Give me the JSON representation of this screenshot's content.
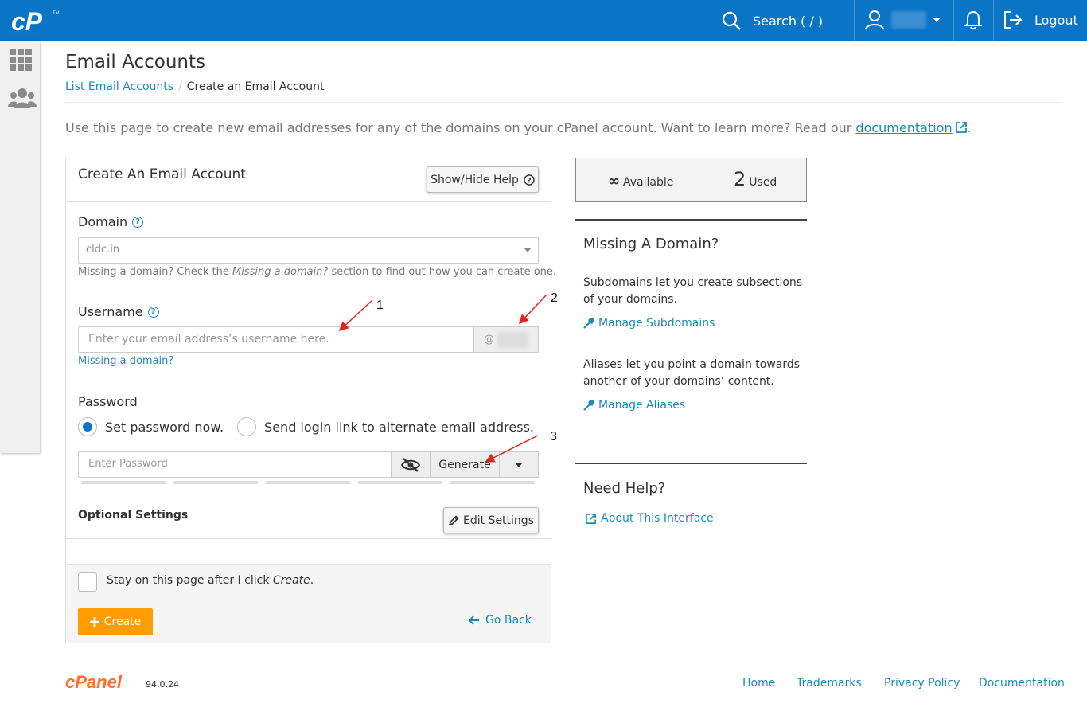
{
  "topbar": {
    "search_label": "Search ( / )",
    "logout_label": "Logout"
  },
  "page": {
    "title": "Email Accounts",
    "breadcrumb_link": "List Email Accounts",
    "breadcrumb_sep": "/",
    "breadcrumb_current": "Create an Email Account",
    "intro_text": "Use this page to create new email addresses for any of the domains on your cPanel account. Want to learn more? Read our",
    "intro_link": "documentation",
    "intro_end": "."
  },
  "form": {
    "title": "Create An Email Account",
    "help_button": "Show/Hide Help",
    "domain_label": "Domain",
    "domain_value": "cldc.in",
    "domain_help_pre": "Missing a domain? Check the",
    "domain_help_em": "Missing a domain?",
    "domain_help_post": "section to find out how you can create one.",
    "username_label": "Username",
    "username_placeholder": "Enter your email address’s username here.",
    "username_at": "@",
    "missing_domain_link": "Missing a domain?",
    "password_label": "Password",
    "radio_set_now": "Set password now.",
    "radio_send_link": "Send login link to alternate email address.",
    "password_placeholder": "Enter Password",
    "generate_label": "Generate",
    "optional_label": "Optional Settings",
    "edit_settings": "Edit Settings",
    "stay_pre": "Stay on this page after I click",
    "stay_em": "Create",
    "stay_post": ".",
    "create_button": "Create",
    "go_back": "Go Back"
  },
  "stats": {
    "available_symbol": "∞",
    "available_label": "Available",
    "used_count": "2",
    "used_label": "Used"
  },
  "right": {
    "missing_title": "Missing A Domain?",
    "subdomains_text": "Subdomains let you create subsections of your domains.",
    "manage_subdomains": "Manage Subdomains",
    "aliases_text": "Aliases let you point a domain towards another of your domains’ content.",
    "manage_aliases": "Manage Aliases",
    "help_title": "Need Help?",
    "about_interface": "About This Interface"
  },
  "annotations": [
    "1",
    "2",
    "3"
  ],
  "footer": {
    "brand": "cPanel",
    "version": "94.0.24",
    "links": [
      "Home",
      "Trademarks",
      "Privacy Policy",
      "Documentation"
    ]
  },
  "colors": {
    "brand_blue": "#0a74c6",
    "link": "#1a8bb8",
    "create_orange": "#ff9c00",
    "cpanel_orange": "#ff6c2c",
    "arrow_red": "#e8231f"
  },
  "icons": [
    "cpanel-logo-icon",
    "search-icon",
    "user-icon",
    "caret-down-icon",
    "bell-icon",
    "logout-icon",
    "grid-icon",
    "users-icon",
    "question-icon",
    "eye-slash-icon",
    "pencil-icon",
    "plus-icon",
    "arrow-left-icon",
    "wrench-icon",
    "external-link-icon",
    "infinity-icon"
  ]
}
